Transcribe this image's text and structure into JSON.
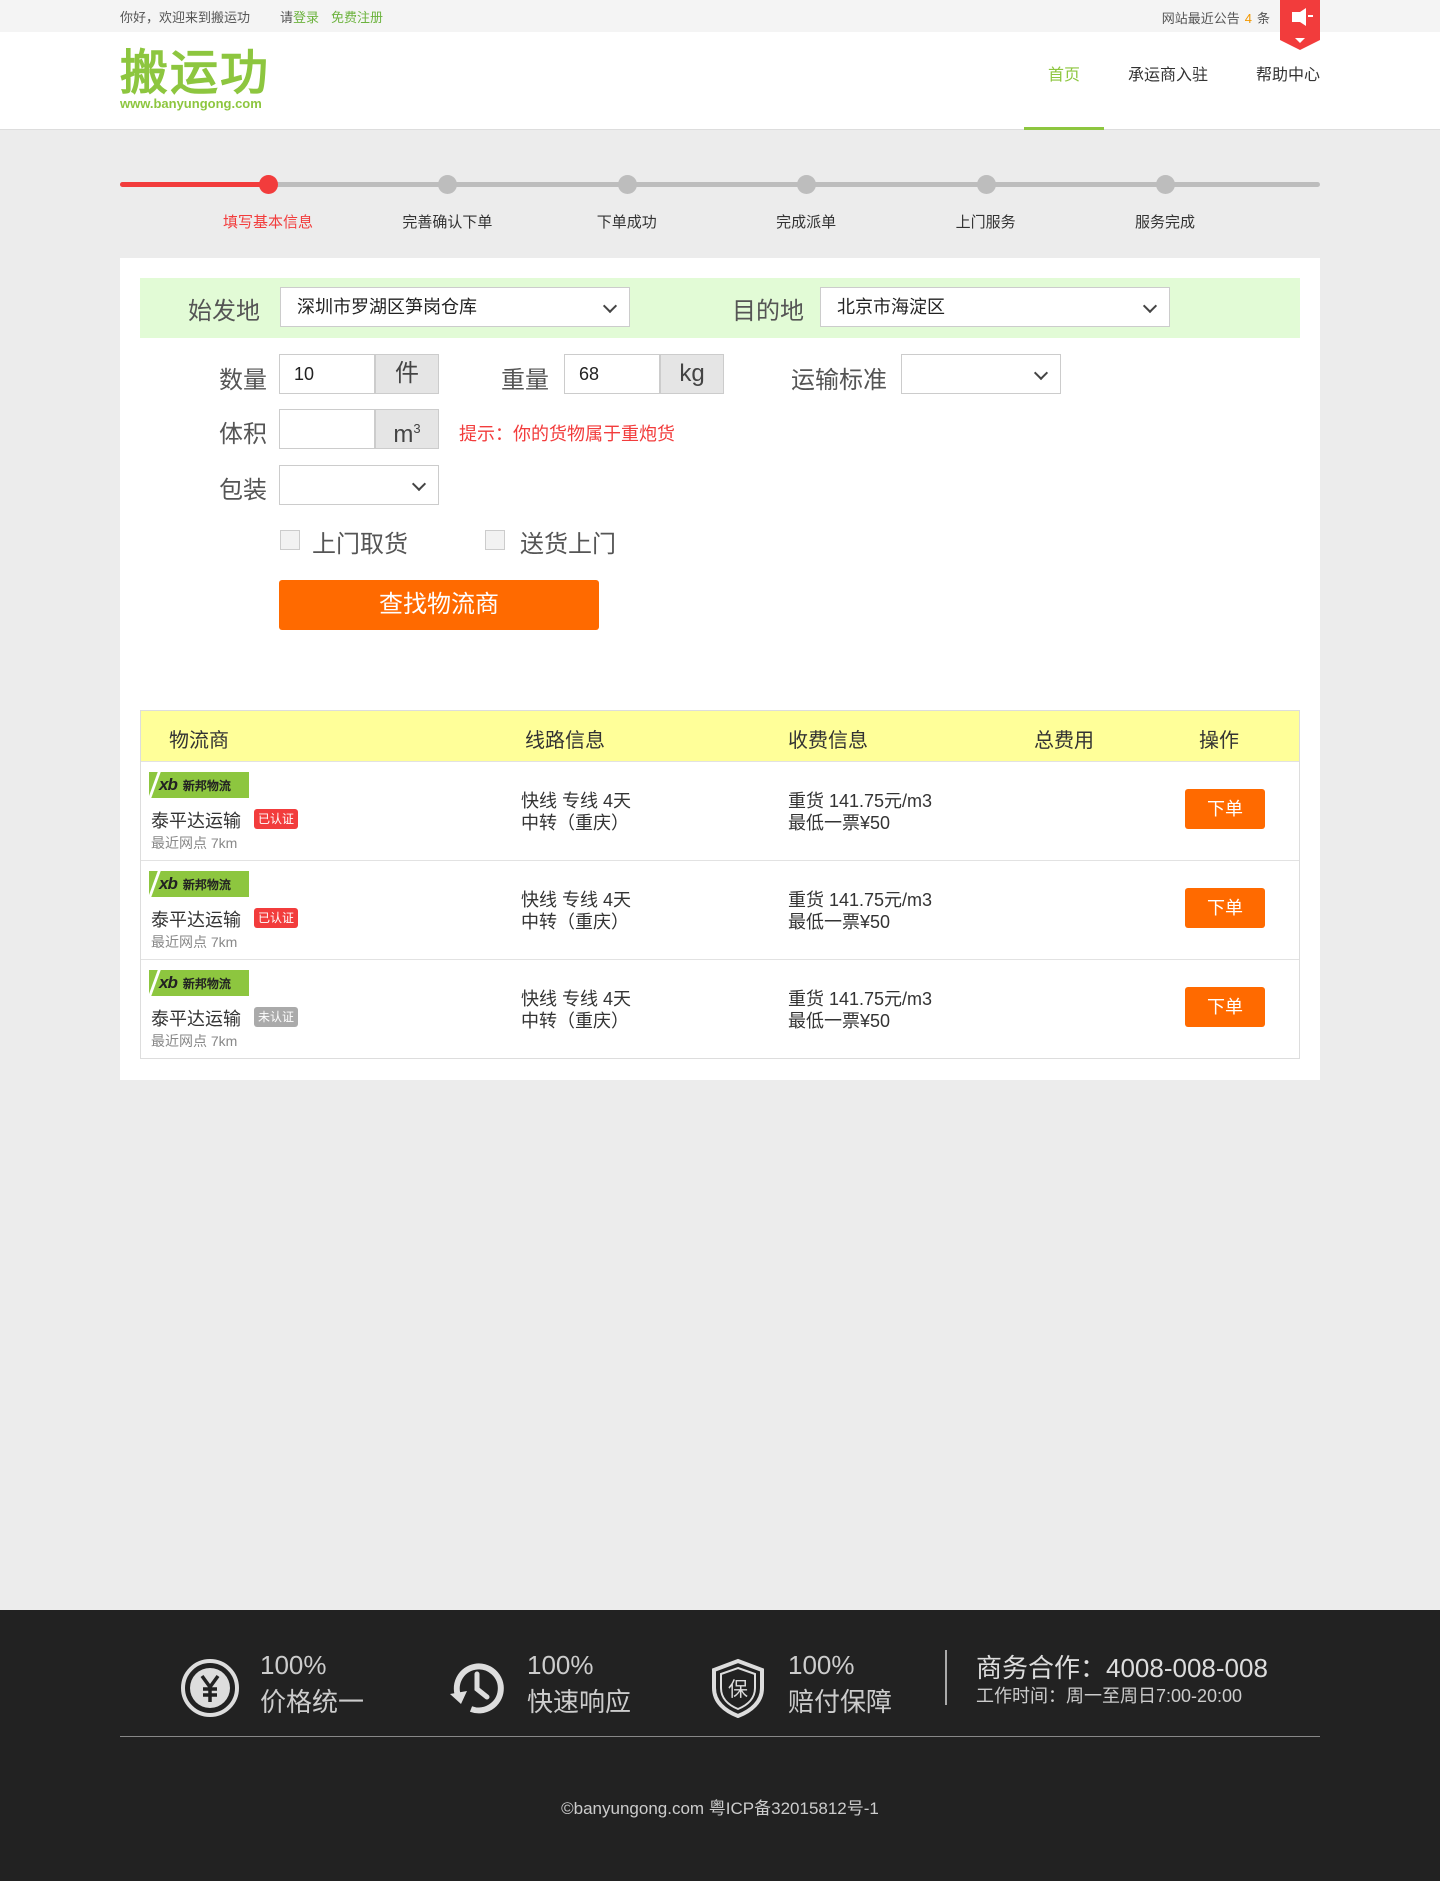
{
  "topbar": {
    "greeting": "你好，欢迎来到搬运功",
    "login_prefix": "请",
    "login": "登录",
    "register": "免费注册",
    "notice_prefix": "网站最近公告",
    "notice_count": "4",
    "notice_suffix": "条"
  },
  "header": {
    "logo_cn": "搬运功",
    "logo_en": "www.banyungong.com",
    "nav": [
      "首页",
      "承运商入驻",
      "帮助中心"
    ],
    "active_nav": "首页"
  },
  "steps": {
    "current": 1,
    "items": [
      "填写基本信息",
      "完善确认下单",
      "下单成功",
      "完成派单",
      "上门服务",
      "服务完成"
    ]
  },
  "form": {
    "origin_label": "始发地",
    "origin_value": "深圳市罗湖区笋岗仓库",
    "dest_label": "目的地",
    "dest_value": "北京市海淀区",
    "qty_label": "数量",
    "qty_value": "10",
    "qty_unit": "件",
    "weight_label": "重量",
    "weight_value": "68",
    "weight_unit": "kg",
    "standard_label": "运输标准",
    "standard_value": "",
    "volume_label": "体积",
    "volume_value": "",
    "volume_unit": "m",
    "volume_unit_sup": "3",
    "hint": "提示：你的货物属于重炮货",
    "pack_label": "包装",
    "pack_value": "",
    "pickup_label": "上门取货",
    "pickup_checked": false,
    "delivery_label": "送货上门",
    "delivery_checked": false,
    "search_button": "查找物流商"
  },
  "results": {
    "headers": [
      "物流商",
      "线路信息",
      "收费信息",
      "总费用",
      "操作"
    ],
    "rows": [
      {
        "logo_mark": "xb",
        "logo_text": "新邦物流",
        "name": "泰平达运输",
        "badge": "已认证",
        "verified": true,
        "distance": "最近网点 7km",
        "route_line1": "快线  专线 4天",
        "route_line2": "中转（重庆）",
        "fee_line1": "重货 141.75元/m3",
        "fee_line2": "最低一票¥50",
        "total": "",
        "action": "下单"
      },
      {
        "logo_mark": "xb",
        "logo_text": "新邦物流",
        "name": "泰平达运输",
        "badge": "已认证",
        "verified": true,
        "distance": "最近网点 7km",
        "route_line1": "快线  专线 4天",
        "route_line2": "中转（重庆）",
        "fee_line1": "重货 141.75元/m3",
        "fee_line2": "最低一票¥50",
        "total": "",
        "action": "下单"
      },
      {
        "logo_mark": "xb",
        "logo_text": "新邦物流",
        "name": "泰平达运输",
        "badge": "未认证",
        "verified": false,
        "distance": "最近网点 7km",
        "route_line1": "快线  专线 4天",
        "route_line2": "中转（重庆）",
        "fee_line1": "重货 141.75元/m3",
        "fee_line2": "最低一票¥50",
        "total": "",
        "action": "下单"
      }
    ]
  },
  "footer": {
    "features": [
      {
        "icon": "yen-circle-icon",
        "percent": "100%",
        "title": "价格统一"
      },
      {
        "icon": "clock-refresh-icon",
        "percent": "100%",
        "title": "快速响应"
      },
      {
        "icon": "shield-guarantee-icon",
        "percent": "100%",
        "title": "赔付保障"
      }
    ],
    "business": "商务合作：4008-008-008",
    "hours": "工作时间：周一至周日7:00-20:00",
    "copyright": "©banyungong.com  粤ICP备32015812号-1"
  },
  "colors": {
    "brand_green": "#8dc63f",
    "accent_orange": "#ff6a00",
    "alert_red": "#f23c3c",
    "route_bg": "#e2fbd6",
    "table_head_bg": "#ffff99",
    "footer_bg": "#222222"
  }
}
